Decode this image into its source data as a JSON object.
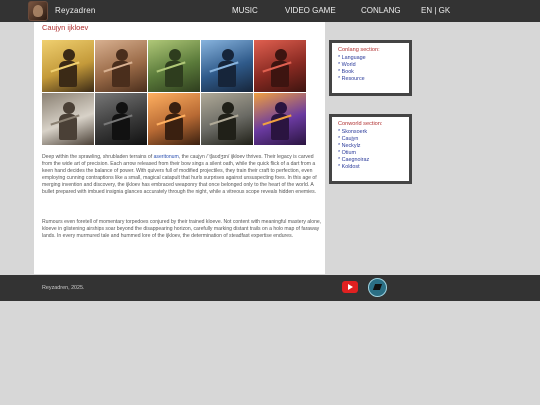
{
  "header": {
    "brand": "Reyzadren",
    "nav": [
      "MUSIC",
      "VIDEO GAME",
      "CONLANG",
      "EN | GK"
    ]
  },
  "main": {
    "title": "Caujyn ijkloev",
    "gallery": [
      {
        "icon": "warrior-portrait",
        "bg": "#c49a3a",
        "fg": "#3b2a16",
        "accent": "#f0d070"
      },
      {
        "icon": "horse-rider",
        "bg": "#9a6a47",
        "fg": "#4a2e1c",
        "accent": "#d8b090"
      },
      {
        "icon": "forest-archer",
        "bg": "#5a7a3a",
        "fg": "#2e3d1e",
        "accent": "#b0c878"
      },
      {
        "icon": "blue-warrior",
        "bg": "#2f5a8a",
        "fg": "#16253a",
        "accent": "#88b4de"
      },
      {
        "icon": "red-warrior",
        "bg": "#8a2a22",
        "fg": "#3d1410",
        "accent": "#e06050"
      },
      {
        "icon": "gunner",
        "bg": "#d8d2c8",
        "fg": "#4a4036",
        "accent": "#8a8072"
      },
      {
        "icon": "ninja",
        "bg": "#3a3a3a",
        "fg": "#111111",
        "accent": "#777777"
      },
      {
        "icon": "fire-crossbow",
        "bg": "#b86a34",
        "fg": "#3a2010",
        "accent": "#ffb060"
      },
      {
        "icon": "twin-fighters",
        "bg": "#6a6a64",
        "fg": "#202018",
        "accent": "#b0aa98"
      },
      {
        "icon": "violet-archer",
        "bg": "#6a3aa0",
        "fg": "#2a1440",
        "accent": "#f0a040"
      }
    ],
    "para1_before": "Deep within the sprawling, shrubladen terrains of ",
    "para1_link": "aseritonum",
    "para1_after": ", the caujyn /ˈtʃaʊdʒɪn/ ijkloev thrives. Their legacy is carved from the wide art of precision. Each arrow released from their bow sings a silent oath, while the quick flick of a dart from a keen hand decides the balance of power. With quivers full of modified projectiles, they train their craft to perfection, even employing cunning contraptions like a small, magical catapult that hurls surprises against unsuspecting foes. In this age of merging invention and discovery, the ijkloev has embraced weaponry that once belonged only to the heart of the world. A bullet prepared with imbued insignia glances accurately through the night, while a vitreous scope reveals hidden enemies.",
    "para2": "Rumours even foretell of momentary torpedoes conjured by their trained kloeve. Not content with meaningful mastery alone, kloeve in glistening airships soar beyond the disappearing horizon, carefully marking distant trails on a holo map of faraway lands. In every murmured tale and hummed lore of the ijkloev, the determination of steadfast expertise endures."
  },
  "sidebar": {
    "conlang": {
      "title": "Conlang section:",
      "items": [
        "* Language",
        "* World",
        "* Book",
        "* Resource"
      ]
    },
    "conworld": {
      "title": "Conworld section:",
      "items": [
        "* Skonsoerk",
        "* Caujyn",
        "* Neckylz",
        "* Otium",
        "* Caegnoiraz",
        "* Koldost"
      ]
    }
  },
  "footer": {
    "text": "Reyzadren, 2025.",
    "icons": [
      "youtube-icon",
      "shape-icon"
    ]
  }
}
